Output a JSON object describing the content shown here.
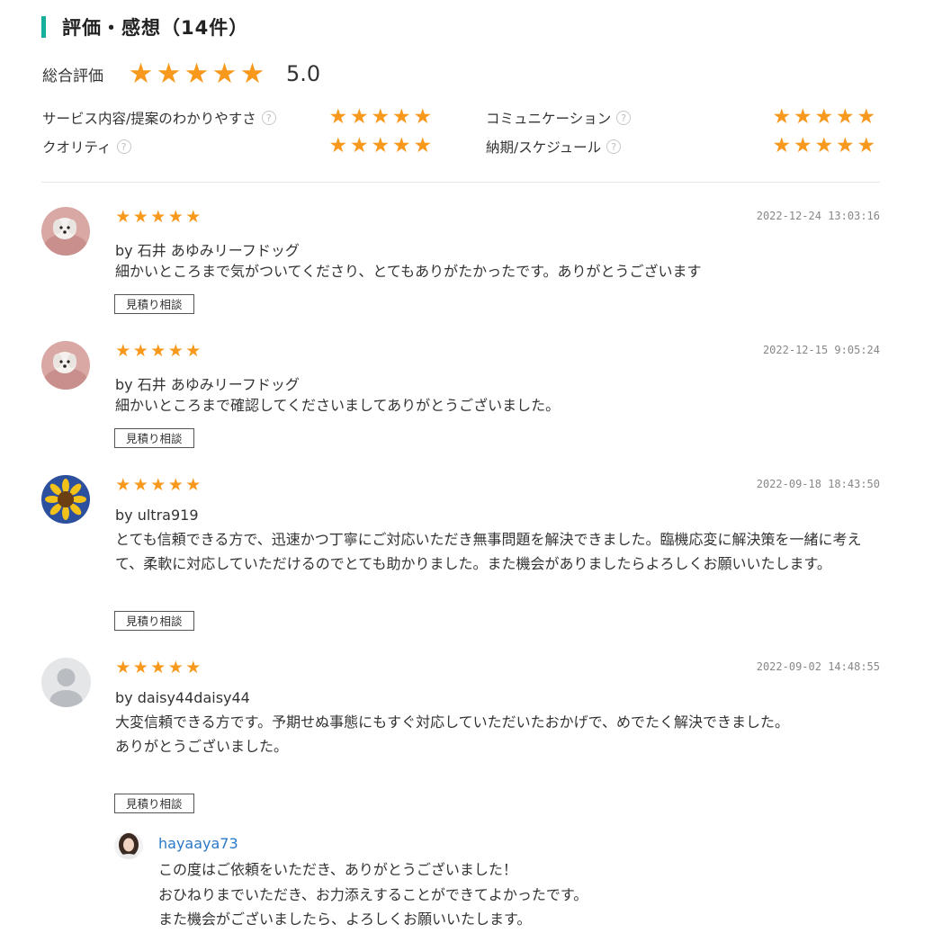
{
  "section": {
    "title": "評価・感想（14件）"
  },
  "overall": {
    "label": "総合評価",
    "score": "5.0",
    "stars": 5
  },
  "sub_ratings": [
    {
      "label": "サービス内容/提案のわかりやすさ",
      "stars": 5
    },
    {
      "label": "コミュニケーション",
      "stars": 5
    },
    {
      "label": "クオリティ",
      "stars": 5
    },
    {
      "label": "納期/スケジュール",
      "stars": 5
    }
  ],
  "star_glyph": "★",
  "help_glyph": "?",
  "colors": {
    "accent": "#14b09c",
    "star": "#f8991d",
    "link": "#2a79c9"
  },
  "reviews": [
    {
      "stars": 5,
      "date": "2022-12-24 13:03:16",
      "by": "by 石井 あゆみリーフドッグ",
      "body": [
        "細かいところまで気がついてくださり、とてもありがたかったです。ありがとうございます"
      ],
      "button": "見積り相談",
      "avatar": "dog-photo"
    },
    {
      "stars": 5,
      "date": "2022-12-15 9:05:24",
      "by": "by 石井 あゆみリーフドッグ",
      "body": [
        "細かいところまで確認してくださいましてありがとうございました。"
      ],
      "button": "見積り相談",
      "avatar": "dog-photo"
    },
    {
      "stars": 5,
      "date": "2022-09-18 18:43:50",
      "by": "by ultra919",
      "body": [
        "とても信頼できる方で、迅速かつ丁寧にご対応いただき無事問題を解決できました。臨機応変に解決策を一緒に考えて、柔軟に対応していただけるのでとても助かりました。また機会がありましたらよろしくお願いいたします。"
      ],
      "button": "見積り相談",
      "avatar": "sunflower-photo"
    },
    {
      "stars": 5,
      "date": "2022-09-02 14:48:55",
      "by": "by daisy44daisy44",
      "body": [
        "大変信頼できる方です。予期せぬ事態にもすぐ対応していただいたおかげで、めでたく解決できました。",
        "ありがとうございました。"
      ],
      "button": "見積り相談",
      "avatar": "default-user"
    }
  ],
  "reply": {
    "name": "hayaaya73",
    "lines": [
      "この度はご依頼をいただき、ありがとうございました！",
      "おひねりまでいただき、お力添えすることができてよかったです。",
      "また機会がございましたら、よろしくお願いいたします。"
    ],
    "avatar": "person-photo"
  }
}
